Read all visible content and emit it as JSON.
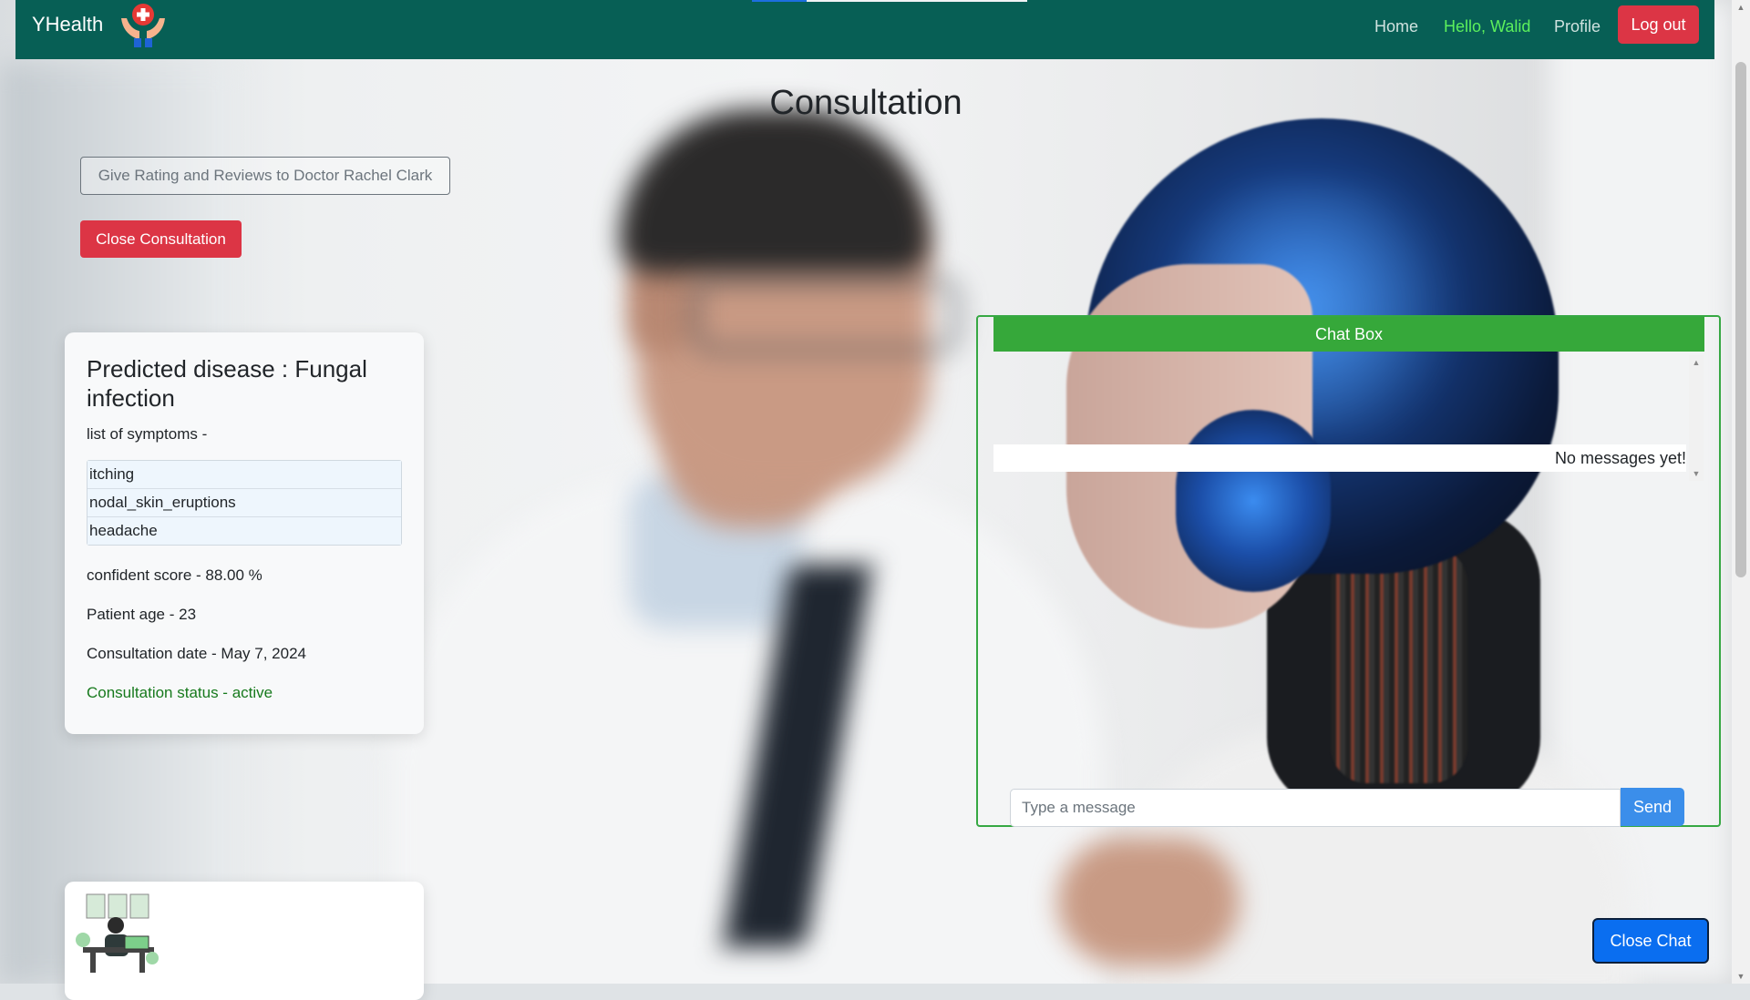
{
  "navbar": {
    "brand": "YHealth",
    "brand_logo_icon": "caring-hands-medical-cross-icon",
    "links": {
      "home": "Home",
      "greeting": "Hello, Walid",
      "profile": "Profile"
    },
    "logout_label": "Log out",
    "colors": {
      "background": "#075f55",
      "greeting": "#5cf05c",
      "logout": "#dc3545"
    }
  },
  "page": {
    "title": "Consultation",
    "rating_button": "Give Rating and Reviews to Doctor Rachel Clark",
    "close_consultation_button": "Close Consultation"
  },
  "prediction_card": {
    "title": "Predicted disease : Fungal infection",
    "symptoms_label": "list of symptoms -",
    "symptoms": [
      "itching",
      "nodal_skin_eruptions",
      "headache"
    ],
    "confidence": "confident score - 88.00 %",
    "patient_age": "Patient age - 23",
    "consultation_date": "Consultation date - May 7, 2024",
    "status": "Consultation status - active"
  },
  "illustration_card": {
    "icon": "person-at-desk-illustration-icon"
  },
  "chat": {
    "header": "Chat Box",
    "empty_text": "No messages yet!",
    "input_placeholder": "Type a message",
    "send_label": "Send",
    "colors": {
      "header": "#36a83a",
      "send": "#3b8eea"
    }
  },
  "close_chat_label": "Close Chat"
}
